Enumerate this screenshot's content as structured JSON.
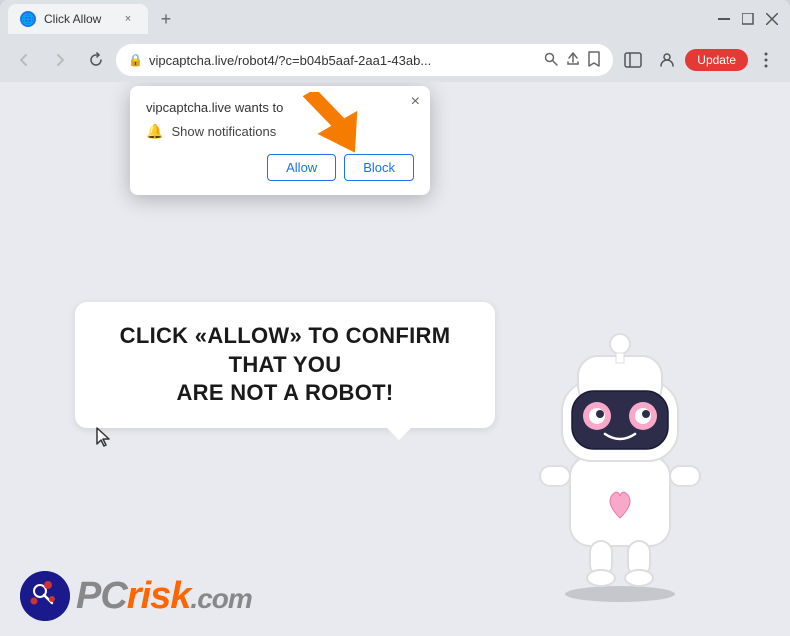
{
  "browser": {
    "tab": {
      "favicon": "🌐",
      "title": "Click Allow",
      "close_label": "×"
    },
    "new_tab_label": "+",
    "window_controls": {
      "minimize": "—",
      "maximize": "□",
      "close": "✕"
    },
    "nav": {
      "back_label": "←",
      "forward_label": "→",
      "reload_label": "↻"
    },
    "address_bar": {
      "url": "vipcaptcha.live/robot4/?c=b04b5aaf-2aa1-43ab...",
      "lock_icon": "🔒"
    },
    "toolbar": {
      "search_icon": "⚲",
      "share_icon": "⬆",
      "bookmark_icon": "☆",
      "sidebar_icon": "⬛",
      "profile_icon": "👤",
      "update_label": "Update",
      "menu_icon": "⋮"
    }
  },
  "notification_popup": {
    "title": "vipcaptcha.live wants to",
    "notification_label": "Show notifications",
    "allow_label": "Allow",
    "block_label": "Block",
    "close_label": "×"
  },
  "page": {
    "bubble_text_line1": "CLICK «ALLOW» TO CONFIRM THAT YOU",
    "bubble_text_line2": "ARE NOT A ROBOT!"
  },
  "logo": {
    "text_gray": "PC",
    "text_orange": "risk",
    "domain": ".com"
  },
  "colors": {
    "accent_blue": "#1a73e8",
    "accent_orange": "#ff6600",
    "update_red": "#e53935",
    "arrow_orange": "#f57c00"
  }
}
